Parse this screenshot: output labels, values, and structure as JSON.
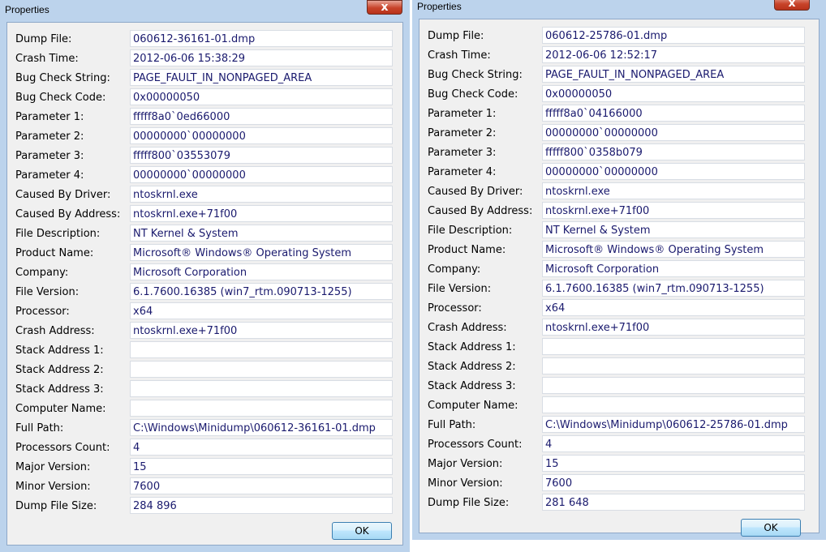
{
  "left": {
    "title": "Properties",
    "close_glyph": "x",
    "ok_label": "OK",
    "rows": [
      {
        "label": "Dump File:",
        "value": "060612-36161-01.dmp"
      },
      {
        "label": "Crash Time:",
        "value": "2012-06-06 15:38:29"
      },
      {
        "label": "Bug Check String:",
        "value": "PAGE_FAULT_IN_NONPAGED_AREA"
      },
      {
        "label": "Bug Check Code:",
        "value": "0x00000050"
      },
      {
        "label": "Parameter 1:",
        "value": "fffff8a0`0ed66000"
      },
      {
        "label": "Parameter 2:",
        "value": "00000000`00000000"
      },
      {
        "label": "Parameter 3:",
        "value": "fffff800`03553079"
      },
      {
        "label": "Parameter 4:",
        "value": "00000000`00000000"
      },
      {
        "label": "Caused By Driver:",
        "value": "ntoskrnl.exe"
      },
      {
        "label": "Caused By Address:",
        "value": "ntoskrnl.exe+71f00"
      },
      {
        "label": "File Description:",
        "value": "NT Kernel & System"
      },
      {
        "label": "Product Name:",
        "value": "Microsoft® Windows® Operating System"
      },
      {
        "label": "Company:",
        "value": "Microsoft Corporation"
      },
      {
        "label": "File Version:",
        "value": "6.1.7600.16385 (win7_rtm.090713-1255)"
      },
      {
        "label": "Processor:",
        "value": "x64"
      },
      {
        "label": "Crash Address:",
        "value": "ntoskrnl.exe+71f00"
      },
      {
        "label": "Stack Address 1:",
        "value": ""
      },
      {
        "label": "Stack Address 2:",
        "value": ""
      },
      {
        "label": "Stack Address 3:",
        "value": ""
      },
      {
        "label": "Computer Name:",
        "value": ""
      },
      {
        "label": "Full Path:",
        "value": "C:\\Windows\\Minidump\\060612-36161-01.dmp"
      },
      {
        "label": "Processors Count:",
        "value": "4"
      },
      {
        "label": "Major Version:",
        "value": "15"
      },
      {
        "label": "Minor Version:",
        "value": "7600"
      },
      {
        "label": "Dump File Size:",
        "value": "284 896"
      }
    ]
  },
  "right": {
    "title": "Properties",
    "close_glyph": "x",
    "ok_label": "OK",
    "rows": [
      {
        "label": "Dump File:",
        "value": "060612-25786-01.dmp"
      },
      {
        "label": "Crash Time:",
        "value": "2012-06-06 12:52:17"
      },
      {
        "label": "Bug Check String:",
        "value": "PAGE_FAULT_IN_NONPAGED_AREA"
      },
      {
        "label": "Bug Check Code:",
        "value": "0x00000050"
      },
      {
        "label": "Parameter 1:",
        "value": "fffff8a0`04166000"
      },
      {
        "label": "Parameter 2:",
        "value": "00000000`00000000"
      },
      {
        "label": "Parameter 3:",
        "value": "fffff800`0358b079"
      },
      {
        "label": "Parameter 4:",
        "value": "00000000`00000000"
      },
      {
        "label": "Caused By Driver:",
        "value": "ntoskrnl.exe"
      },
      {
        "label": "Caused By Address:",
        "value": "ntoskrnl.exe+71f00"
      },
      {
        "label": "File Description:",
        "value": "NT Kernel & System"
      },
      {
        "label": "Product Name:",
        "value": "Microsoft® Windows® Operating System"
      },
      {
        "label": "Company:",
        "value": "Microsoft Corporation"
      },
      {
        "label": "File Version:",
        "value": "6.1.7600.16385 (win7_rtm.090713-1255)"
      },
      {
        "label": "Processor:",
        "value": "x64"
      },
      {
        "label": "Crash Address:",
        "value": "ntoskrnl.exe+71f00"
      },
      {
        "label": "Stack Address 1:",
        "value": ""
      },
      {
        "label": "Stack Address 2:",
        "value": ""
      },
      {
        "label": "Stack Address 3:",
        "value": ""
      },
      {
        "label": "Computer Name:",
        "value": ""
      },
      {
        "label": "Full Path:",
        "value": "C:\\Windows\\Minidump\\060612-25786-01.dmp"
      },
      {
        "label": "Processors Count:",
        "value": "4"
      },
      {
        "label": "Major Version:",
        "value": "15"
      },
      {
        "label": "Minor Version:",
        "value": "7600"
      },
      {
        "label": "Dump File Size:",
        "value": "281 648"
      }
    ]
  }
}
